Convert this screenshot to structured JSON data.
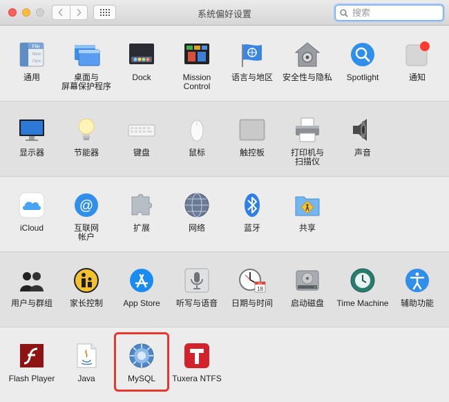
{
  "window": {
    "title": "系统偏好设置"
  },
  "search": {
    "placeholder": "搜索"
  },
  "rows": [
    [
      {
        "label": "通用",
        "icon": "general-icon"
      },
      {
        "label": "桌面与\n屏幕保护程序",
        "icon": "desktop-screensaver-icon"
      },
      {
        "label": "Dock",
        "icon": "dock-icon"
      },
      {
        "label": "Mission\nControl",
        "icon": "mission-control-icon"
      },
      {
        "label": "语言与地区",
        "icon": "language-region-icon"
      },
      {
        "label": "安全性与隐私",
        "icon": "security-privacy-icon"
      },
      {
        "label": "Spotlight",
        "icon": "spotlight-icon"
      },
      {
        "label": "通知",
        "icon": "notifications-icon"
      }
    ],
    [
      {
        "label": "显示器",
        "icon": "displays-icon"
      },
      {
        "label": "节能器",
        "icon": "energy-saver-icon"
      },
      {
        "label": "键盘",
        "icon": "keyboard-icon"
      },
      {
        "label": "鼠标",
        "icon": "mouse-icon"
      },
      {
        "label": "触控板",
        "icon": "trackpad-icon"
      },
      {
        "label": "打印机与\n扫描仪",
        "icon": "printers-scanners-icon"
      },
      {
        "label": "声音",
        "icon": "sound-icon"
      }
    ],
    [
      {
        "label": "iCloud",
        "icon": "icloud-icon"
      },
      {
        "label": "互联网\n帐户",
        "icon": "internet-accounts-icon"
      },
      {
        "label": "扩展",
        "icon": "extensions-icon"
      },
      {
        "label": "网络",
        "icon": "network-icon"
      },
      {
        "label": "蓝牙",
        "icon": "bluetooth-icon"
      },
      {
        "label": "共享",
        "icon": "sharing-icon"
      }
    ],
    [
      {
        "label": "用户与群组",
        "icon": "users-groups-icon"
      },
      {
        "label": "家长控制",
        "icon": "parental-controls-icon"
      },
      {
        "label": "App Store",
        "icon": "app-store-icon"
      },
      {
        "label": "听写与语音",
        "icon": "dictation-speech-icon"
      },
      {
        "label": "日期与时间",
        "icon": "date-time-icon"
      },
      {
        "label": "启动磁盘",
        "icon": "startup-disk-icon"
      },
      {
        "label": "Time Machine",
        "icon": "time-machine-icon"
      },
      {
        "label": "辅助功能",
        "icon": "accessibility-icon"
      }
    ],
    [
      {
        "label": "Flash Player",
        "icon": "flash-player-icon"
      },
      {
        "label": "Java",
        "icon": "java-icon"
      },
      {
        "label": "MySQL",
        "icon": "mysql-icon"
      },
      {
        "label": "Tuxera NTFS",
        "icon": "tuxera-ntfs-icon"
      }
    ]
  ],
  "calendar_icon_text": {
    "month": "JUL",
    "day": "18"
  },
  "highlighted_item": "MySQL",
  "colors": {
    "highlight": "#e8352d",
    "notification_dot": "#ff3b30",
    "search_focus": "#6fa6ef"
  }
}
